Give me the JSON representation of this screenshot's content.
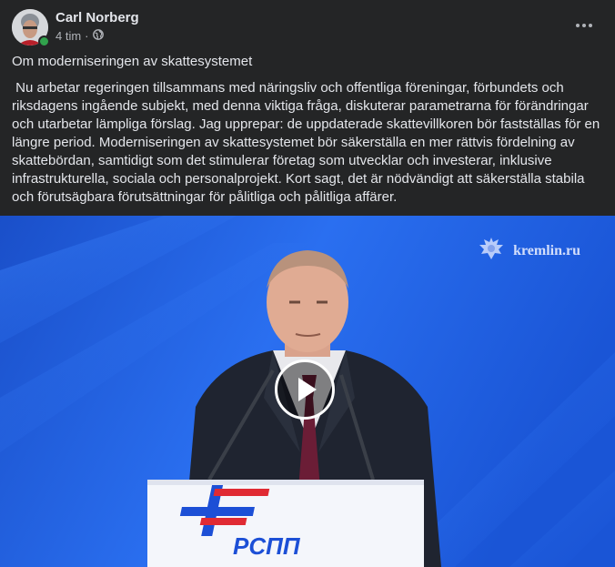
{
  "post": {
    "author": "Carl Norberg",
    "time": "4 tim",
    "separator": "·",
    "privacy_icon": "globe-icon",
    "title": "Om moderniseringen av skattesystemet",
    "body": " Nu arbetar regeringen tillsammans med näringsliv och offentliga föreningar, förbundets och riksdagens ingående subjekt, med denna viktiga fråga, diskuterar parametrarna för förändringar och utarbetar lämpliga förslag. Jag upprepar: de uppdaterade skattevillkoren bör fastställas för en längre period. Moderniseringen av skattesystemet bör säkerställa en mer rättvis fördelning av skattebördan, samtidigt som det stimulerar företag som utvecklar och investerar, inklusive infrastrukturella, sociala och personalprojekt. Kort sagt, det är nödvändigt att säkerställa stabila och förutsägbara förutsättningar för pålitliga och pålitliga affärer."
  },
  "video": {
    "watermark": "kremlin.ru",
    "podium_logo": "РСПП",
    "play_icon": "play-icon"
  },
  "colors": {
    "background": "#242526",
    "text": "#e4e6eb",
    "secondary_text": "#b0b3b8",
    "online": "#31a24c",
    "video_blue": "#1c5bd4"
  }
}
